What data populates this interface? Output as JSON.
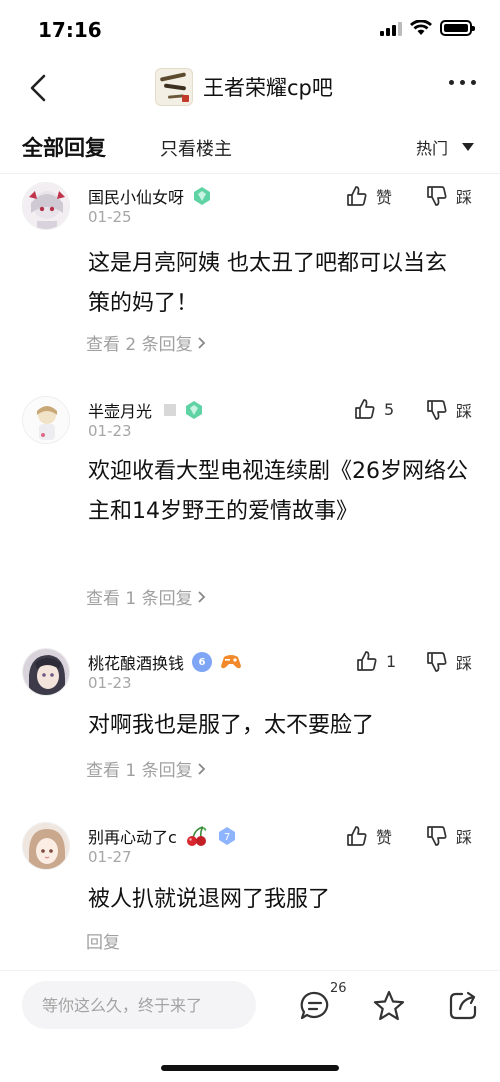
{
  "status_bar": {
    "time": "17:16"
  },
  "nav": {
    "title": "王者荣耀cp吧"
  },
  "tabs": {
    "all": "全部回复",
    "host_only": "只看楼主"
  },
  "sort": {
    "selected": "热门"
  },
  "replies": [
    {
      "user": "国民小仙女呀",
      "date": "01-25",
      "like_label": "赞",
      "dislike_label": "踩",
      "content": "这是月亮阿姨 也太丑了吧都可以当玄策的妈了！",
      "view_replies": "查看 2 条回复"
    },
    {
      "user": "半壶月光",
      "date": "01-23",
      "like_label": "5",
      "dislike_label": "踩",
      "content": "欢迎收看大型电视连续剧《26岁网络公主和14岁野王的爱情故事》",
      "view_replies": "查看 1 条回复"
    },
    {
      "user": "桃花酿酒换钱",
      "date": "01-23",
      "level_badge": "6",
      "like_label": "1",
      "dislike_label": "踩",
      "content": "对啊我也是服了，太不要脸了",
      "view_replies": "查看 1 条回复"
    },
    {
      "user": "别再心动了c",
      "date": "01-27",
      "level_badge": "7",
      "like_label": "赞",
      "dislike_label": "踩",
      "content": "被人扒就说退网了我服了",
      "view_replies": "回复"
    }
  ],
  "bottom_bar": {
    "input_placeholder": "等你这么久，终于来了",
    "comment_count": "26"
  },
  "colors": {
    "gem_green": "#5fd3a4",
    "level_blue": "#7ea6f5",
    "level_light_blue": "#8fb4ff",
    "muted_text": "#a0a0a0"
  }
}
